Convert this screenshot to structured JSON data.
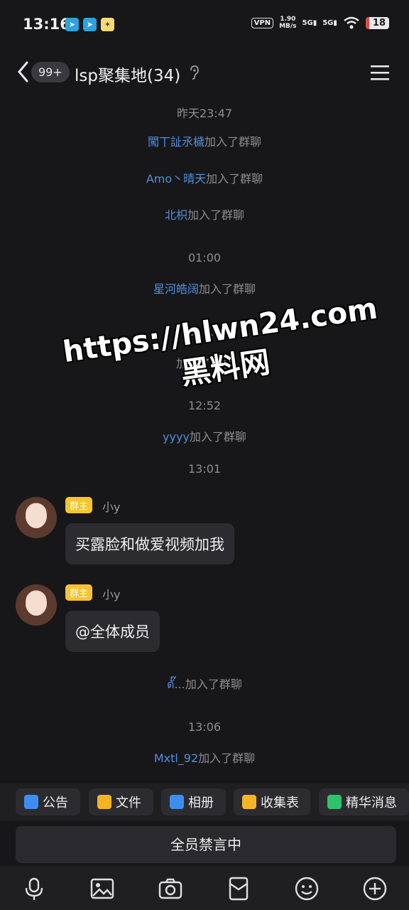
{
  "status_bar": {
    "time": "13:16",
    "vpn": "VPN",
    "speed_value": "1.90",
    "speed_unit": "MB/s",
    "sig1": "5G",
    "sig2": "5G",
    "battery": "18"
  },
  "header": {
    "unread_badge": "99+",
    "title": "lsp聚集地(34)"
  },
  "chat": {
    "entries": [
      {
        "type": "time",
        "text": "昨天23:47"
      },
      {
        "type": "join",
        "name": "闖丅訨氶檅",
        "suffix": "加入了群聊"
      },
      {
        "type": "join",
        "name": "Amo丶晴天",
        "suffix": "加入了群聊"
      },
      {
        "type": "join",
        "name": "北枳",
        "suffix": "加入了群聊"
      },
      {
        "type": "time",
        "text": "01:00"
      },
      {
        "type": "join",
        "name": "星河皓阔",
        "suffix": "加入了群聊"
      },
      {
        "type": "time",
        "text": "01:13"
      },
      {
        "type": "join",
        "name": "",
        "suffix": "加入了群聊"
      },
      {
        "type": "time",
        "text": "12:52"
      },
      {
        "type": "join",
        "name": "yyyy",
        "suffix": "加入了群聊"
      },
      {
        "type": "time",
        "text": "13:01"
      },
      {
        "type": "message",
        "role": "群主",
        "sender": "小y",
        "text": "买露脸和做爱视频加我"
      },
      {
        "type": "message",
        "role": "群主",
        "sender": "小y",
        "text": "@全体成员"
      },
      {
        "type": "join",
        "name": "ดั๊...",
        "suffix": "加入了群聊"
      },
      {
        "type": "time",
        "text": "13:06"
      },
      {
        "type": "join",
        "name": "Mxtl_92",
        "suffix": "加入了群聊"
      }
    ]
  },
  "watermark": {
    "url": "https://hlwn24.com",
    "name": "黑料网"
  },
  "quick_actions": [
    {
      "label": "公告",
      "icon": "announcement-icon"
    },
    {
      "label": "文件",
      "icon": "folder-icon"
    },
    {
      "label": "相册",
      "icon": "album-icon"
    },
    {
      "label": "收集表",
      "icon": "form-icon"
    },
    {
      "label": "精华消息",
      "icon": "essence-icon"
    }
  ],
  "muted_notice": "全员禁言中",
  "toolbar": [
    "mic-icon",
    "image-icon",
    "camera-icon",
    "red-packet-icon",
    "emoji-icon",
    "plus-icon"
  ],
  "colors": {
    "background": "#17171a",
    "link_blue": "#4f8fdb",
    "owner_badge": "#f6c431"
  }
}
